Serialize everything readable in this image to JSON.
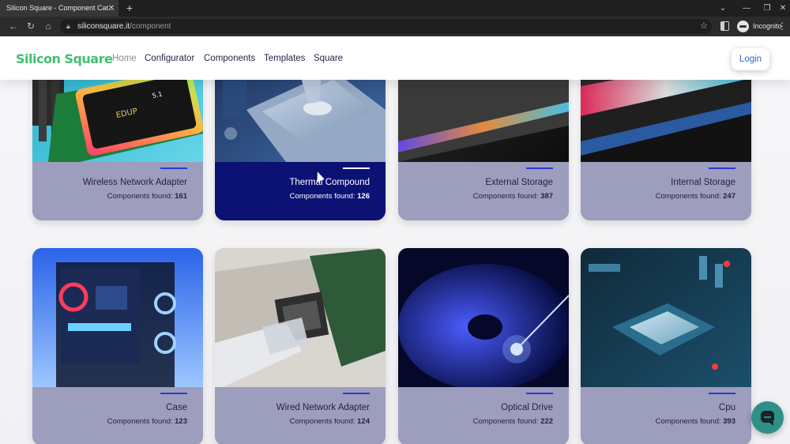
{
  "browser": {
    "tab_title": "Silicon Square - Component Cat...",
    "tab_close": "✕",
    "new_tab": "+",
    "url_host": "siliconsquare.it",
    "url_path": "/component",
    "incognito_label": "Incognito",
    "icons": [
      "back-icon",
      "forward-icon",
      "reload-icon",
      "home-icon",
      "lock-icon",
      "star-icon",
      "side-panel-icon",
      "incognito-icon",
      "menu-icon"
    ]
  },
  "header": {
    "logo_text_1": "Silicon ",
    "logo_text_2": "Square",
    "nav": [
      "Home",
      "Configurator",
      "Components",
      "Templates",
      "Square"
    ],
    "login": "Login"
  },
  "cards": [
    {
      "title": "Wireless Network Adapter",
      "label": "Components found: ",
      "count": "161",
      "image": "wifi-card-image"
    },
    {
      "title": "Thermal Compound",
      "label": "Components found: ",
      "count": "126",
      "image": "thermal-paste-image"
    },
    {
      "title": "External Storage",
      "label": "Components found: ",
      "count": "387",
      "image": "external-ssd-image"
    },
    {
      "title": "Internal Storage",
      "label": "Components found: ",
      "count": "247",
      "image": "ram-image"
    },
    {
      "title": "Case",
      "label": "Components found: ",
      "count": "123",
      "image": "pc-case-image"
    },
    {
      "title": "Wired Network Adapter",
      "label": "Components found: ",
      "count": "124",
      "image": "ethernet-image"
    },
    {
      "title": "Optical Drive",
      "label": "Components found: ",
      "count": "222",
      "image": "bluray-disc-image"
    },
    {
      "title": "Cpu",
      "label": "Components found: ",
      "count": "393",
      "image": "cpu-image"
    }
  ],
  "active_card_index": 1,
  "colors": {
    "card_footer": "#9d9dbd",
    "card_footer_active": "#0c1174",
    "accent_line": "#2b37d6",
    "logo_green": "#47b062",
    "login_text": "#2c6ad6",
    "chat_fab": "#2d8f86"
  }
}
